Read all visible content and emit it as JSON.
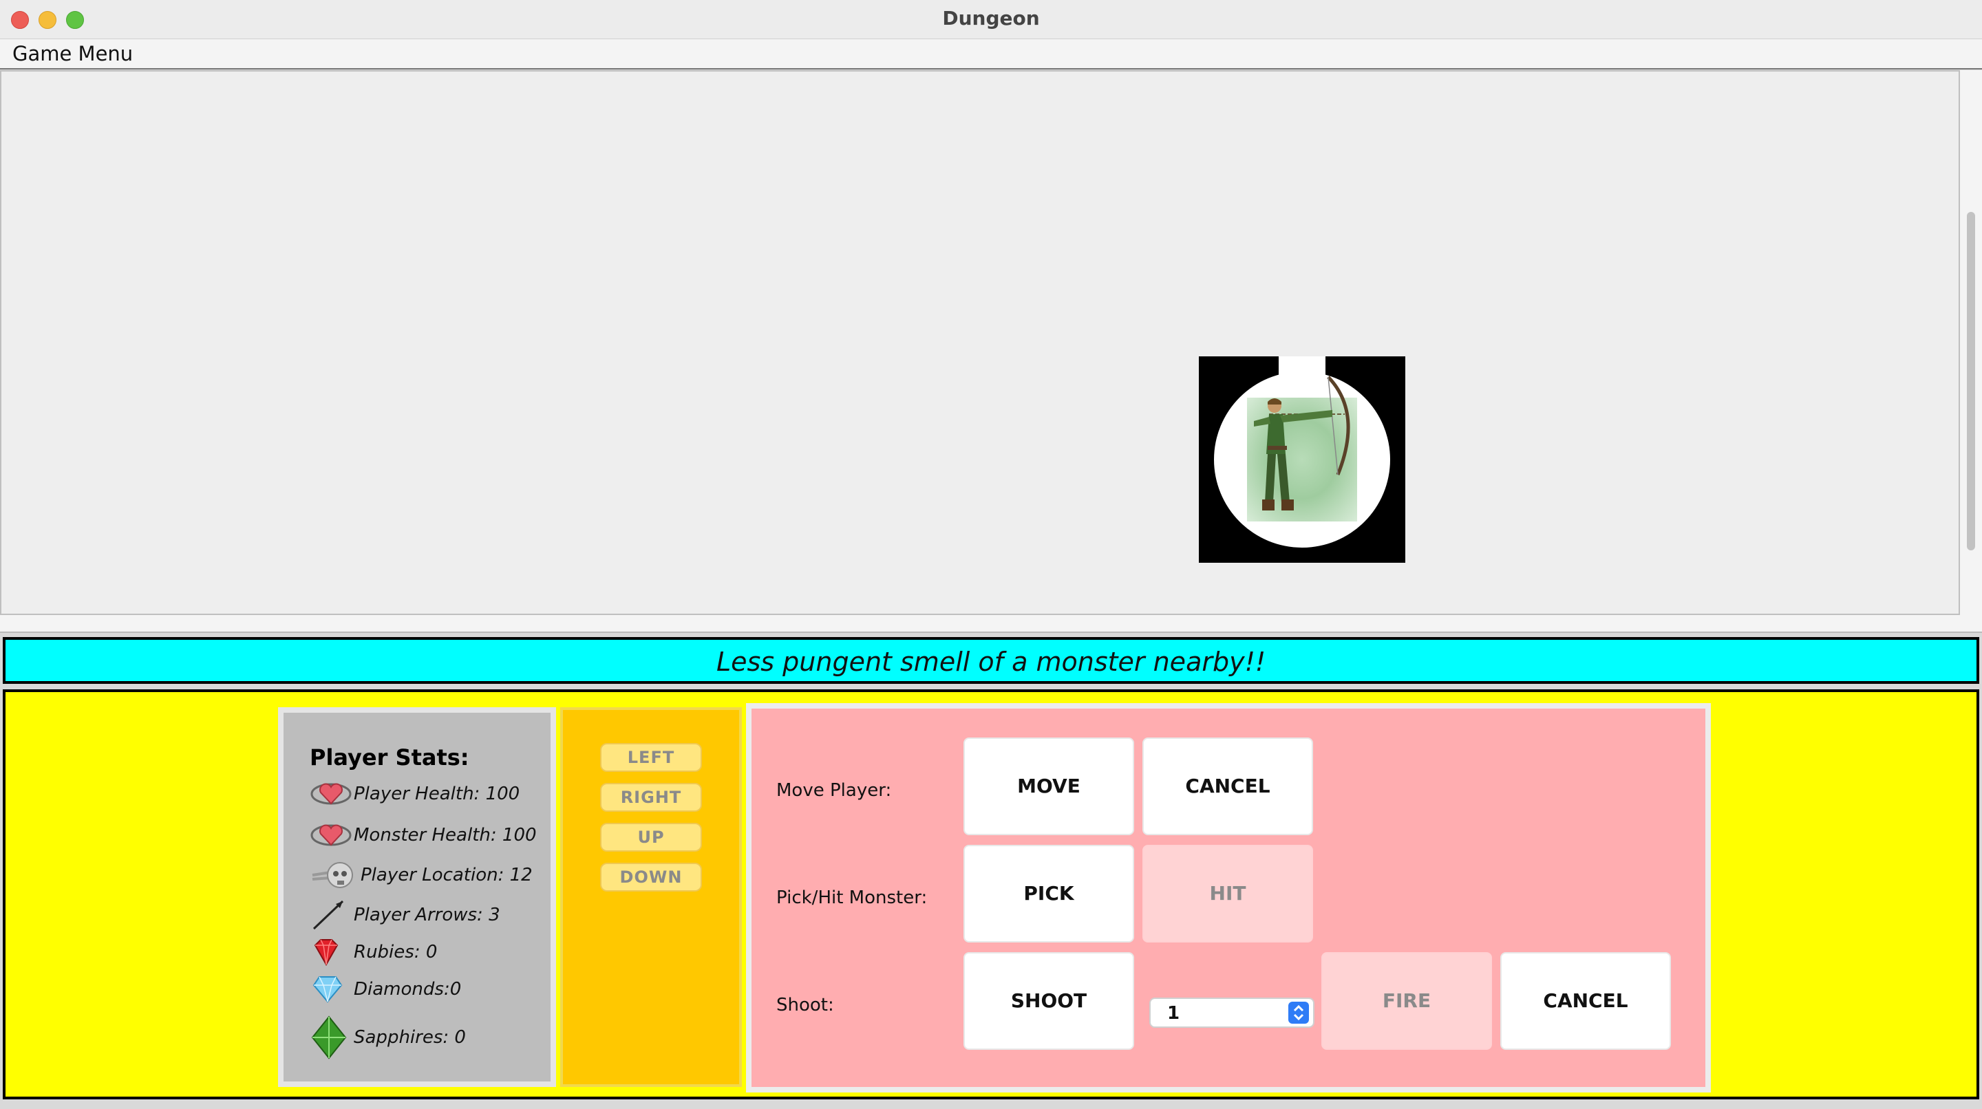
{
  "window": {
    "title": "Dungeon"
  },
  "menu": {
    "game_menu": "Game Menu"
  },
  "status": {
    "message": "Less pungent smell of a monster nearby!!"
  },
  "stats": {
    "title": "Player Stats:",
    "items": [
      {
        "label": "Player Health: 100",
        "icon": "heart-icon"
      },
      {
        "label": "Monster Health: 100",
        "icon": "heart-icon"
      },
      {
        "label": "Player Location: 12",
        "icon": "skull-icon"
      },
      {
        "label": "Player Arrows: 3",
        "icon": "arrow-icon"
      },
      {
        "label": "Rubies: 0",
        "icon": "ruby-icon"
      },
      {
        "label": "Diamonds:0",
        "icon": "diamond-icon"
      },
      {
        "label": "Sapphires: 0",
        "icon": "sapphire-icon"
      }
    ]
  },
  "directions": {
    "left": "LEFT",
    "right": "RIGHT",
    "up": "UP",
    "down": "DOWN"
  },
  "actions": {
    "move_label": "Move Player:",
    "move_button": "MOVE",
    "move_cancel": "CANCEL",
    "pick_label": "Pick/Hit Monster:",
    "pick_button": "PICK",
    "hit_button": "HIT",
    "shoot_label": "Shoot:",
    "shoot_button": "SHOOT",
    "distance_value": "1",
    "fire_button": "FIRE",
    "shoot_cancel": "CANCEL"
  },
  "colors": {
    "status_bg": "#00ffff",
    "panel_bg": "#ffff00",
    "stats_bg": "#bdbdbd",
    "dir_bg": "#ffc800",
    "actions_bg": "#ffadb0"
  }
}
